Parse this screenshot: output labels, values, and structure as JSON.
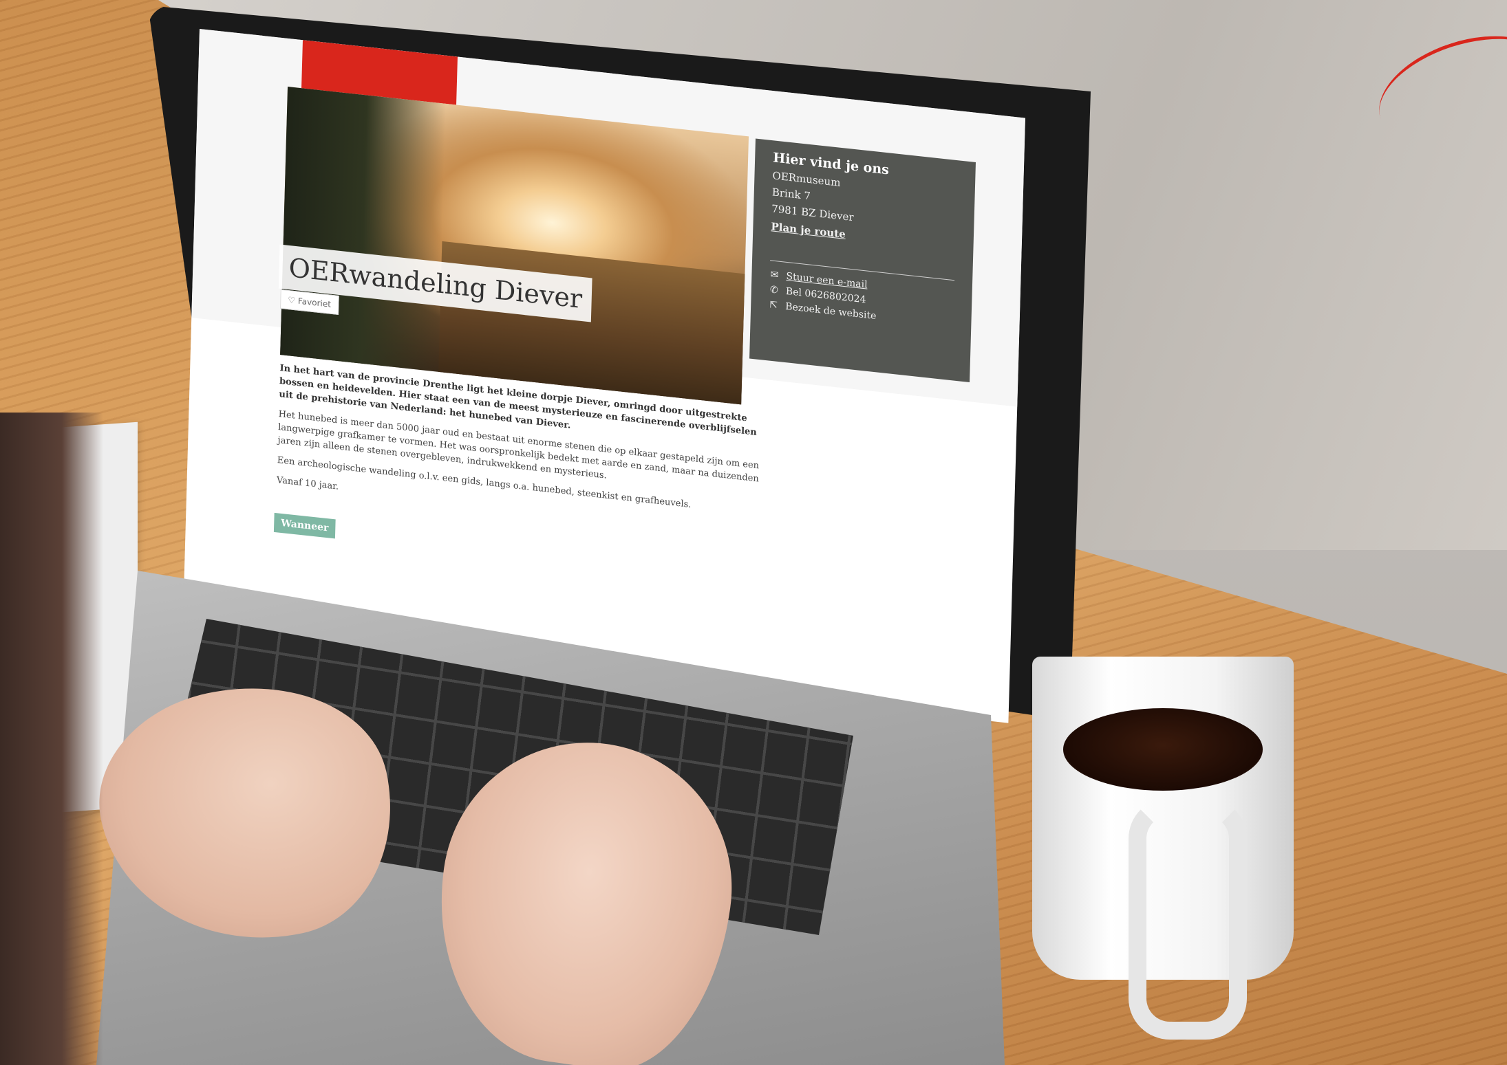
{
  "page": {
    "title": "OERwandeling Diever",
    "favorite_label": "Favoriet",
    "info": {
      "heading": "Hier vind je ons",
      "name": "OERmuseum",
      "street": "Brink 7",
      "city": "7981 BZ Diever",
      "route_link": "Plan je route",
      "email_link": "Stuur een e-mail",
      "phone": "Bel 0626802024",
      "website_link": "Bezoek de website"
    },
    "body": {
      "lead": "In het hart van de provincie Drenthe ligt het kleine dorpje Diever, omringd door uitgestrekte bossen en heidevelden. Hier staat een van de meest mysterieuze en fascinerende overblijfselen uit de prehistorie van Nederland: het hunebed van Diever.",
      "p2": "Het hunebed is meer dan 5000 jaar oud en bestaat uit enorme stenen die op elkaar gestapeld zijn om een langwerpige grafkamer te vormen. Het was oorspronkelijk bedekt met aarde en zand, maar na duizenden jaren zijn alleen de stenen overgebleven, indrukwekkend en mysterieus.",
      "p3": "Een archeologische wandeling o.l.v. een gids, langs o.a. hunebed, steenkist en grafheuvels.",
      "p4": "Vanaf 10 jaar."
    },
    "wanneer_label": "Wanneer"
  },
  "colors": {
    "brand_red": "#d9261c",
    "info_panel": "#545652",
    "accent_green": "#7fb8a4"
  }
}
